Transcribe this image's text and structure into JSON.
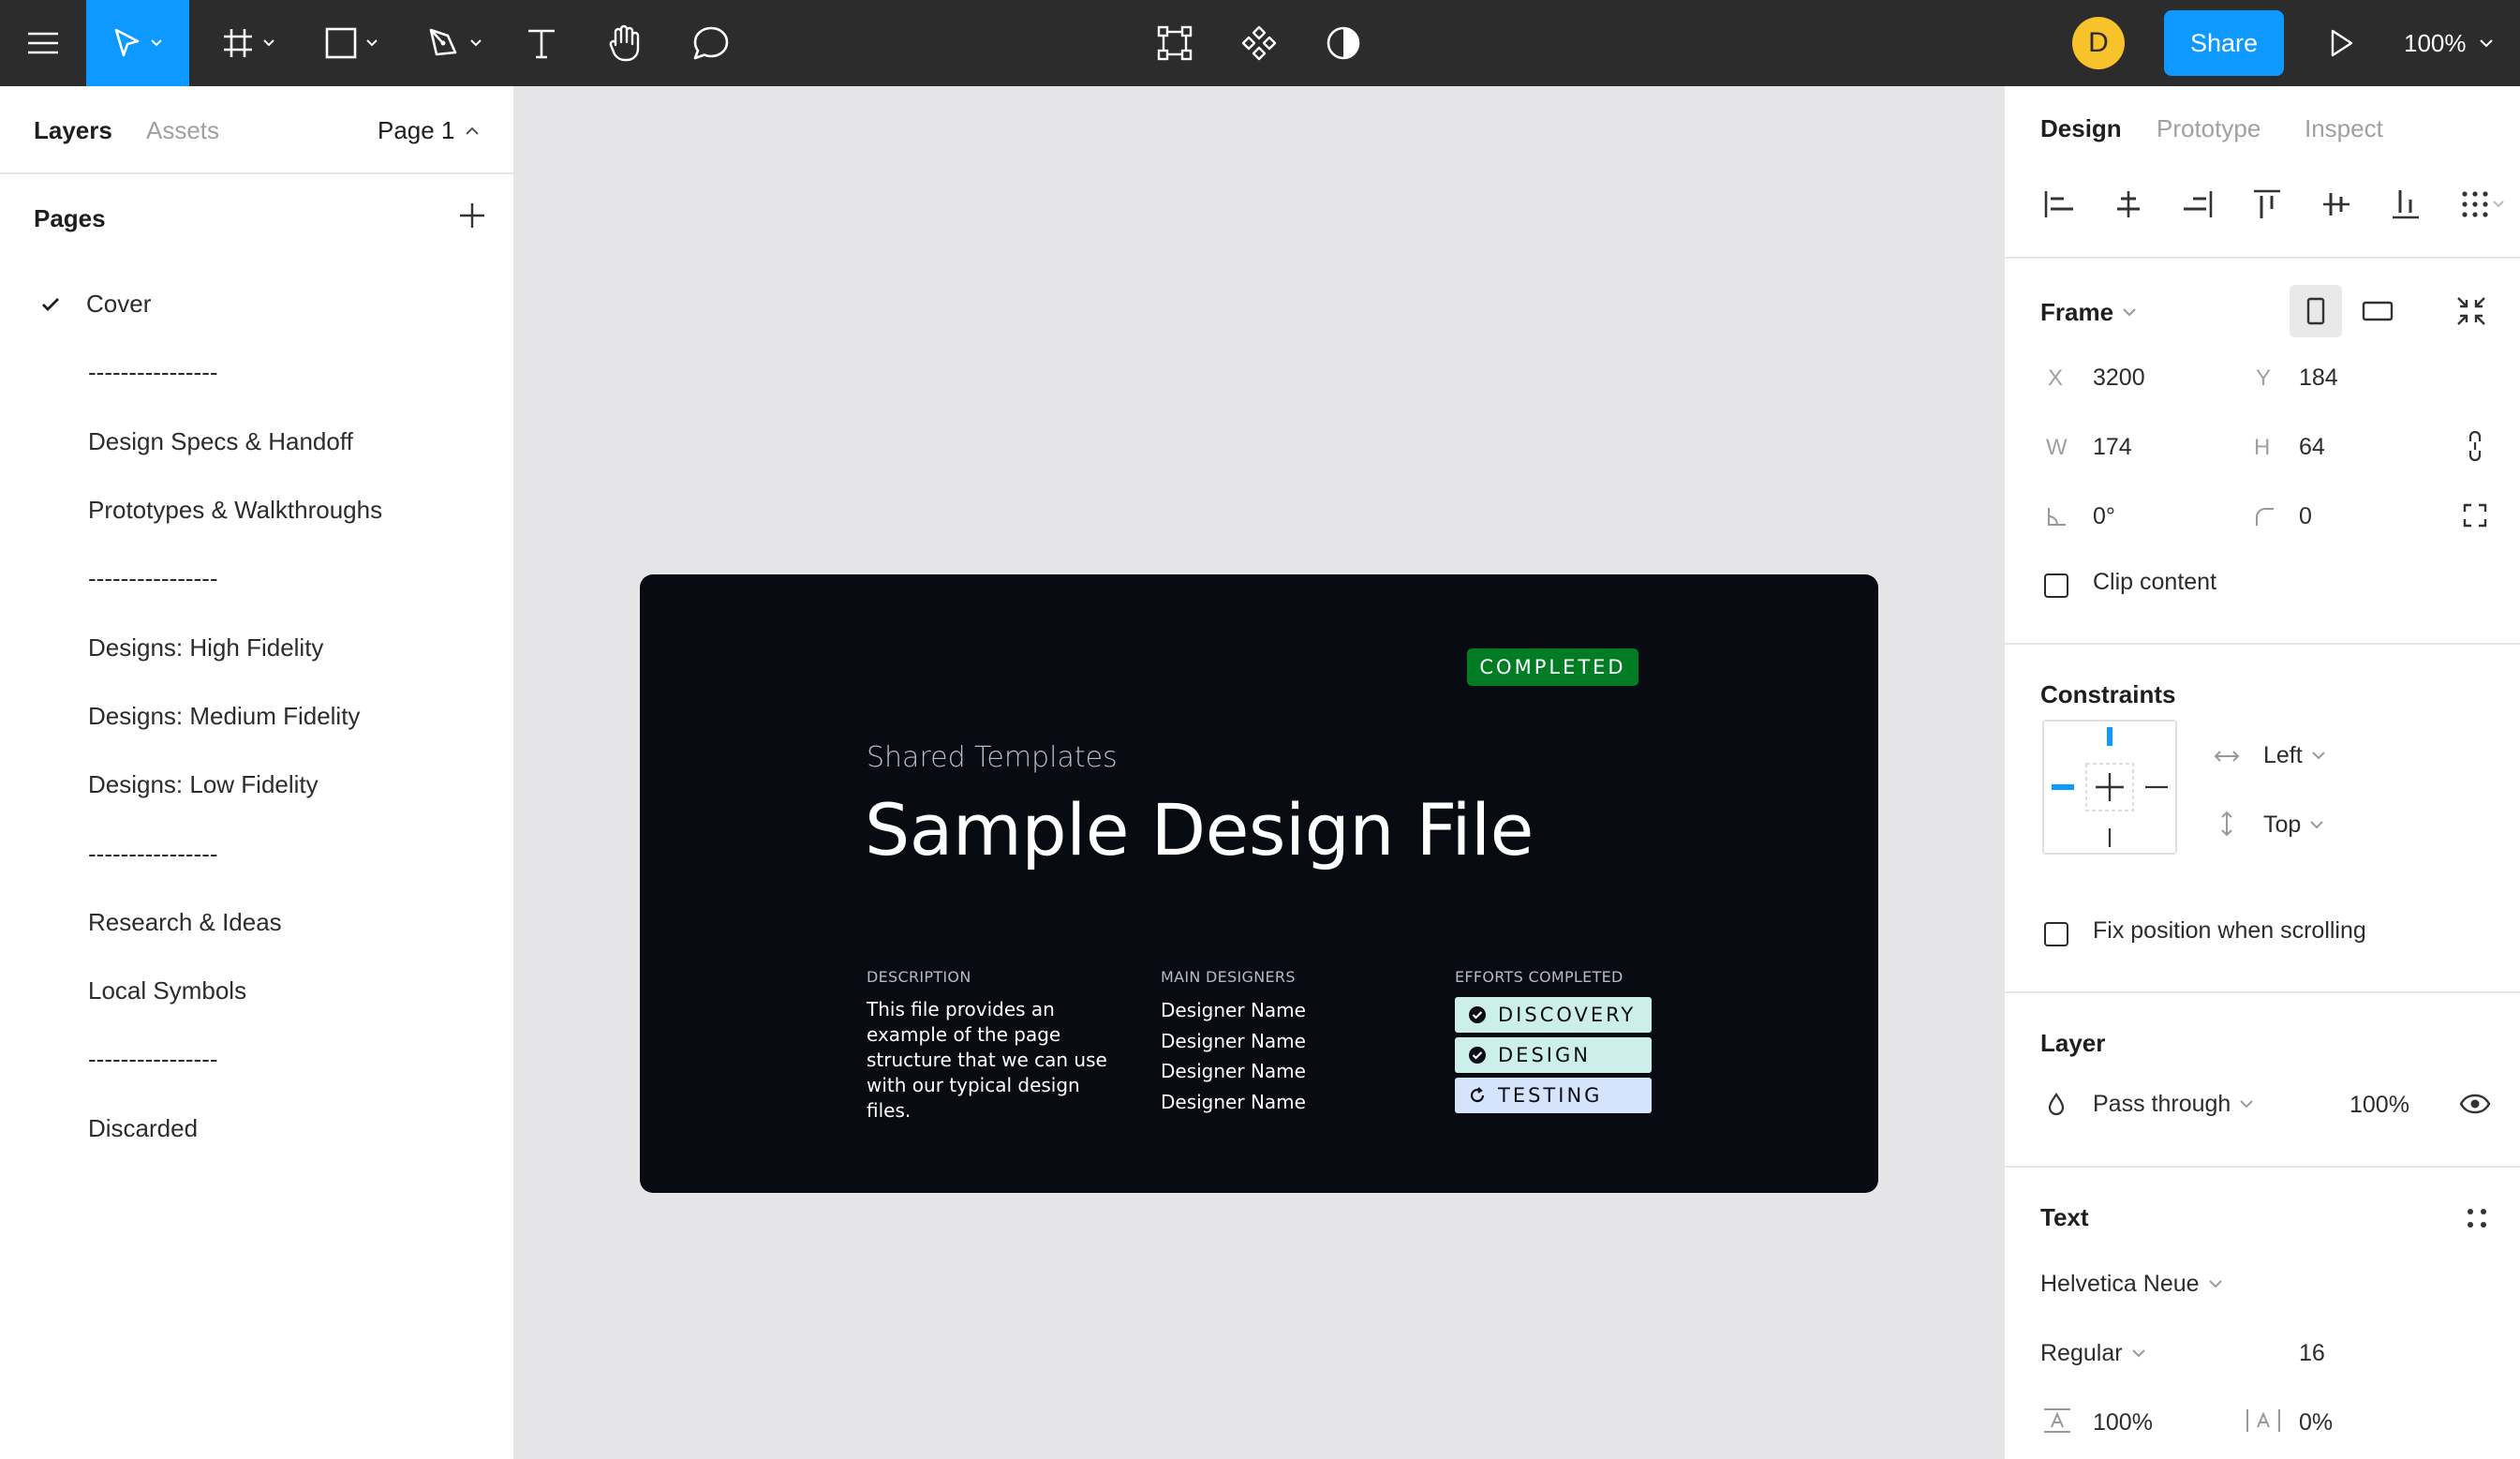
{
  "toolbar": {
    "menu_icon": "hamburger-icon",
    "tools": [
      "move-tool",
      "frame-tool",
      "shape-tool",
      "pen-tool",
      "text-tool",
      "hand-tool",
      "comment-tool"
    ],
    "center_tools": [
      "edit-object-icon",
      "component-icon",
      "contrast-icon"
    ],
    "avatar_initial": "D",
    "avatar_color": "#f8c22b",
    "share_label": "Share",
    "zoom": "100%",
    "accent": "#0d99ff"
  },
  "left_panel": {
    "tabs": {
      "layers": "Layers",
      "assets": "Assets"
    },
    "page_selector": "Page 1",
    "pages_title": "Pages",
    "pages": [
      {
        "label": "Cover",
        "current": true
      },
      {
        "label": "----------------",
        "current": false
      },
      {
        "label": "Design Specs & Handoff",
        "current": false
      },
      {
        "label": "Prototypes & Walkthroughs",
        "current": false
      },
      {
        "label": "----------------",
        "current": false
      },
      {
        "label": "Designs: High Fidelity",
        "current": false
      },
      {
        "label": "Designs: Medium Fidelity",
        "current": false
      },
      {
        "label": "Designs: Low Fidelity",
        "current": false
      },
      {
        "label": "----------------",
        "current": false
      },
      {
        "label": "Research & Ideas",
        "current": false
      },
      {
        "label": "Local Symbols",
        "current": false
      },
      {
        "label": "----------------",
        "current": false
      },
      {
        "label": "Discarded",
        "current": false
      }
    ]
  },
  "canvas": {
    "frame": {
      "badge": "COMPLETED",
      "badge_color": "#017c25",
      "kicker": "Shared Templates",
      "title": "Sample Design File",
      "description_label": "DESCRIPTION",
      "description": "This file provides an example of the page structure that we can use with our typical design files.",
      "designers_label": "MAIN DESIGNERS",
      "designers": [
        "Designer Name",
        "Designer Name",
        "Designer Name",
        "Designer Name"
      ],
      "efforts_label": "EFFORTS COMPLETED",
      "efforts": [
        {
          "label": "DISCOVERY",
          "status": "done",
          "icon": "check-circle-icon"
        },
        {
          "label": "DESIGN",
          "status": "done",
          "icon": "check-circle-icon"
        },
        {
          "label": "TESTING",
          "status": "in-progress",
          "icon": "refresh-icon"
        }
      ]
    }
  },
  "right_panel": {
    "tabs": {
      "design": "Design",
      "prototype": "Prototype",
      "inspect": "Inspect"
    },
    "frame": {
      "title": "Frame",
      "x_label": "X",
      "x": "3200",
      "y_label": "Y",
      "y": "184",
      "w_label": "W",
      "w": "174",
      "h_label": "H",
      "h": "64",
      "rotation": "0°",
      "radius": "0",
      "clip_content": "Clip content"
    },
    "constraints": {
      "title": "Constraints",
      "horizontal": "Left",
      "vertical": "Top",
      "fix_position": "Fix position when scrolling"
    },
    "layer": {
      "title": "Layer",
      "blend": "Pass through",
      "opacity": "100%"
    },
    "text": {
      "title": "Text",
      "font": "Helvetica Neue",
      "weight": "Regular",
      "size": "16",
      "line_height": "100%",
      "letter_spacing": "0%"
    }
  }
}
